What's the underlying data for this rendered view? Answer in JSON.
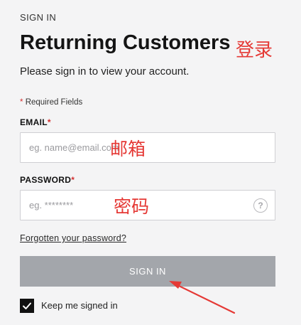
{
  "header": {
    "eyebrow": "SIGN IN",
    "title": "Returning Customers",
    "subtitle": "Please sign in to view your account."
  },
  "annotations": {
    "login": "登录",
    "email": "邮箱",
    "password": "密码",
    "color": "#e53935"
  },
  "form": {
    "required_note": "Required Fields",
    "required_star": "*",
    "email": {
      "label": "EMAIL",
      "value": "",
      "placeholder": "eg. name@email.com"
    },
    "password": {
      "label": "PASSWORD",
      "value": "",
      "placeholder": "eg. ********",
      "help_icon": "question-circle-icon",
      "help_glyph": "?"
    },
    "forgot_link": "Forgotten your password?",
    "submit_label": "SIGN IN",
    "submit_color": "#a3a6ab",
    "keep_signed_in": {
      "label": "Keep me signed in",
      "checked": true
    }
  }
}
